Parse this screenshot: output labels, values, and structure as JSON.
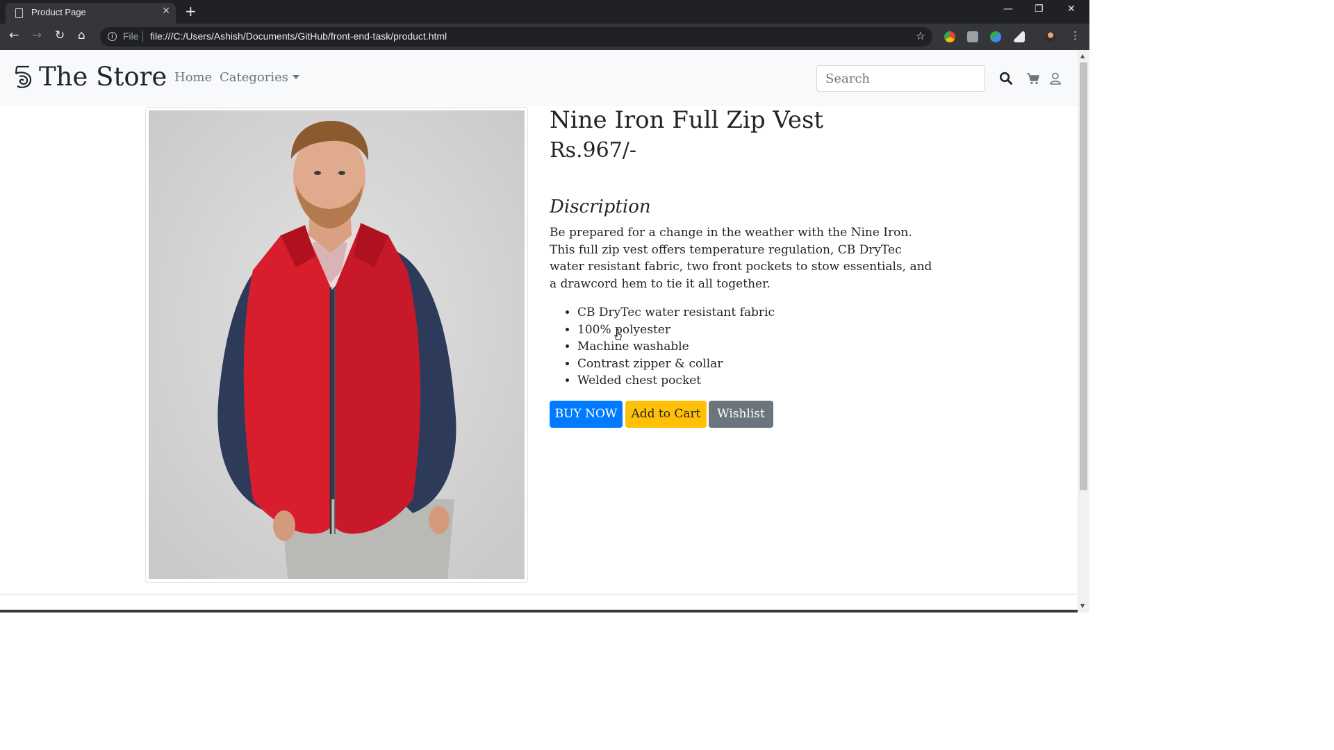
{
  "browser": {
    "tab_title": "Product Page",
    "tab_close": "✕",
    "new_tab": "+",
    "file_label": "File",
    "url": "file:///C:/Users/Ashish/Documents/GitHub/front-end-task/product.html",
    "controls": {
      "minimize": "—",
      "restore": "❐",
      "close": "✕"
    },
    "nav": {
      "back": "←",
      "forward": "→",
      "reload": "↻",
      "home": "⌂"
    },
    "star": "☆",
    "menu": "⋮"
  },
  "site": {
    "brand": "The Store",
    "nav": {
      "home": "Home",
      "categories": "Categories"
    },
    "search_placeholder": "Search"
  },
  "product": {
    "title": "Nine Iron Full Zip Vest",
    "price": "Rs.967/-",
    "description_heading": "Discription",
    "description": "Be prepared for a change in the weather with the Nine Iron. This full zip vest offers temperature regulation, CB DryTec water resistant fabric, two front pockets to stow essentials, and a drawcord hem to tie it all together.",
    "features": [
      "CB DryTec water resistant fabric",
      "100% polyester",
      "Machine washable",
      "Contrast zipper & collar",
      "Welded chest pocket"
    ],
    "buttons": {
      "buy": "BUY NOW",
      "cart": "Add to Cart",
      "wishlist": "Wishlist"
    }
  },
  "colors": {
    "primary": "#007bff",
    "warning": "#ffc107",
    "secondary": "#6c757d",
    "navbar_bg": "#f8f9fa",
    "chrome_dark": "#202124",
    "chrome_toolbar": "#35363a"
  }
}
